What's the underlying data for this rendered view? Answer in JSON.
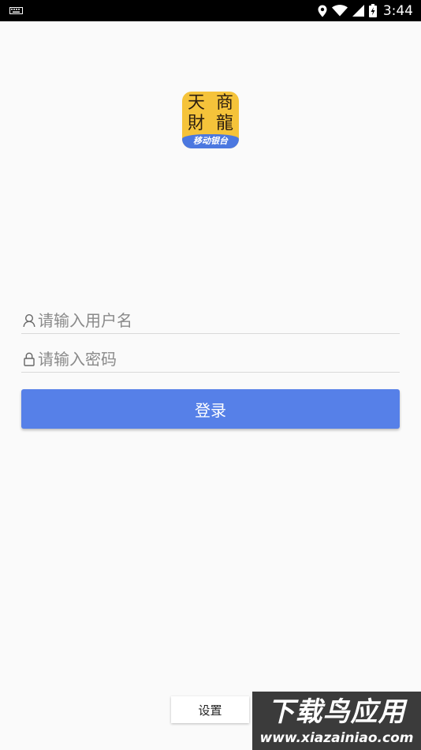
{
  "status_bar": {
    "time": "3:44"
  },
  "logo": {
    "chars": [
      "天",
      "商",
      "財",
      "龍"
    ],
    "caption": "移动银台"
  },
  "form": {
    "username_placeholder": "请输入用户名",
    "password_placeholder": "请输入密码",
    "login_label": "登录"
  },
  "footer": {
    "settings_label": "设置"
  },
  "watermark": {
    "title": "下载鸟应用",
    "url": "www.xiazainiao.com"
  },
  "colors": {
    "primary": "#5680e8",
    "logo_yellow": "#f5c33a",
    "logo_blue": "#4b78e0"
  }
}
